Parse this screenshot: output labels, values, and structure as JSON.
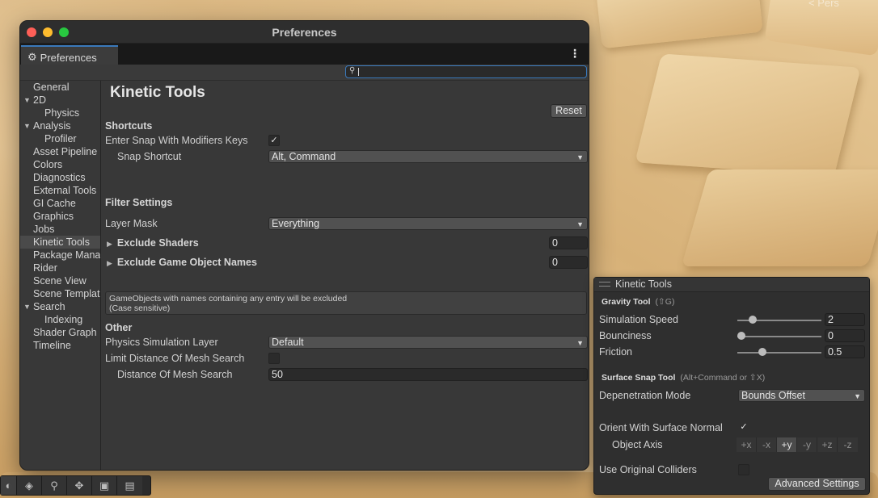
{
  "scene": {
    "corner_text": "< Pers"
  },
  "window": {
    "title": "Preferences",
    "tab_label": "Preferences",
    "menu_icon": "⋮",
    "search": {
      "value": "",
      "placeholder": ""
    }
  },
  "sidebar": {
    "items": [
      {
        "label": "General",
        "level": 0
      },
      {
        "label": "2D",
        "level": 0,
        "expanded": true
      },
      {
        "label": "Physics",
        "level": 1
      },
      {
        "label": "Analysis",
        "level": 0,
        "expanded": true
      },
      {
        "label": "Profiler",
        "level": 1
      },
      {
        "label": "Asset Pipeline",
        "level": 0
      },
      {
        "label": "Colors",
        "level": 0
      },
      {
        "label": "Diagnostics",
        "level": 0
      },
      {
        "label": "External Tools",
        "level": 0
      },
      {
        "label": "GI Cache",
        "level": 0
      },
      {
        "label": "Graphics",
        "level": 0
      },
      {
        "label": "Jobs",
        "level": 0
      },
      {
        "label": "Kinetic Tools",
        "level": 0,
        "selected": true
      },
      {
        "label": "Package Manager",
        "level": 0
      },
      {
        "label": "Rider",
        "level": 0
      },
      {
        "label": "Scene View",
        "level": 0
      },
      {
        "label": "Scene Template",
        "level": 0
      },
      {
        "label": "Search",
        "level": 0,
        "expanded": true
      },
      {
        "label": "Indexing",
        "level": 1
      },
      {
        "label": "Shader Graph",
        "level": 0
      },
      {
        "label": "Timeline",
        "level": 0
      }
    ]
  },
  "content": {
    "title": "Kinetic Tools",
    "reset_label": "Reset",
    "shortcuts": {
      "heading": "Shortcuts",
      "enter_snap_label": "Enter Snap With Modifiers Keys",
      "enter_snap_checked": true,
      "snap_shortcut_label": "Snap Shortcut",
      "snap_shortcut_value": "Alt, Command"
    },
    "filter": {
      "heading": "Filter Settings",
      "layer_mask_label": "Layer Mask",
      "layer_mask_value": "Everything",
      "exclude_shaders_label": "Exclude Shaders",
      "exclude_shaders_count": "0",
      "exclude_names_label": "Exclude Game Object Names",
      "exclude_names_count": "0",
      "help_line1": "GameObjects with names containing any entry will be excluded",
      "help_line2": "(Case sensitive)"
    },
    "other": {
      "heading": "Other",
      "physics_layer_label": "Physics Simulation Layer",
      "physics_layer_value": "Default",
      "limit_distance_label": "Limit Distance Of Mesh Search",
      "limit_distance_checked": false,
      "distance_label": "Distance Of Mesh Search",
      "distance_value": "50"
    }
  },
  "toolbar": {
    "buttons": [
      "view-tool-icon",
      "grid-icon",
      "search-icon",
      "move-tool-icon",
      "camera-icon",
      "overlay-icon"
    ]
  },
  "overlay": {
    "title": "Kinetic Tools",
    "gravity": {
      "heading": "Gravity Tool",
      "hint": "(⇧G)",
      "sim_speed_label": "Simulation Speed",
      "sim_speed_value": "2",
      "sim_speed_level": 0.15,
      "bounciness_label": "Bounciness",
      "bounciness_value": "0",
      "bounciness_level": 0.0,
      "friction_label": "Friction",
      "friction_value": "0.5",
      "friction_level": 0.28
    },
    "surface": {
      "heading": "Surface Snap Tool",
      "hint": "(Alt+Command  or  ⇧X)",
      "depenetration_label": "Depenetration Mode",
      "depenetration_value": "Bounds Offset",
      "orient_label": "Orient With Surface Normal",
      "orient_checked": true,
      "object_axis_label": "Object Axis",
      "axes": [
        "+x",
        "-x",
        "+y",
        "-y",
        "+z",
        "-z"
      ],
      "active_axis": "+y",
      "original_colliders_label": "Use Original Colliders",
      "original_colliders_checked": false,
      "advanced_label": "Advanced Settings"
    }
  }
}
